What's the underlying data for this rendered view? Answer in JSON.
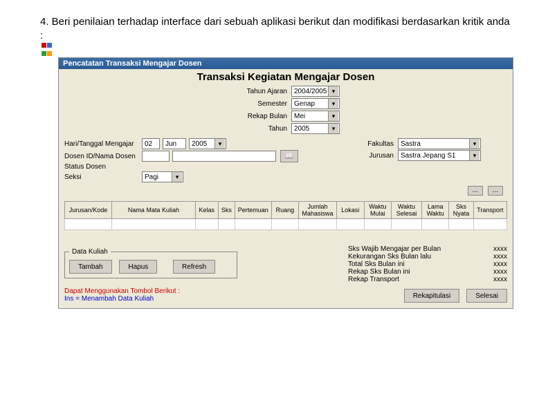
{
  "question": "4. Beri penilaian terhadap interface dari sebuah aplikasi berikut dan modifikasi berdasarkan kritik anda :",
  "window_title": "Pencatatan Transaksi Mengajar Dosen",
  "header": "Transaksi Kegiatan Mengajar Dosen",
  "top": {
    "tahun_ajaran_lbl": "Tahun Ajaran",
    "tahun_ajaran_val": "2004/2005",
    "semester_lbl": "Semester",
    "semester_val": "Genap",
    "rekap_bulan_lbl": "Rekap Bulan",
    "rekap_bulan_val": "Mei",
    "tahun_lbl": "Tahun",
    "tahun_val": "2005"
  },
  "left": {
    "hari_lbl": "Hari/Tanggal Mengajar",
    "hari_d": "02",
    "hari_m": "Jun",
    "hari_y": "2005",
    "dosen_lbl": "Dosen ID/Nama Dosen",
    "dosen_id": "",
    "dosen_nama": "",
    "status_lbl": "Status Dosen",
    "seksi_lbl": "Seksi",
    "seksi_val": "Pagi"
  },
  "right": {
    "fakultas_lbl": "Fakultas",
    "fakultas_val": "Sastra",
    "jurusan_lbl": "Jurusan",
    "jurusan_val": "Sastra Jepang S1"
  },
  "pager": {
    "p1": "...",
    "p2": "..."
  },
  "cols": {
    "c1": "Jurusan/Kode",
    "c2": "Nama Mata Kuliah",
    "c3": "Kelas",
    "c4": "Sks",
    "c5": "Pertemuan",
    "c6": "Ruang",
    "c7": "Jumlah Mahasiswa",
    "c8": "Lokasi",
    "c9": "Waktu Mulai",
    "c10": "Waktu Selesai",
    "c11": "Lama Waktu",
    "c12": "Sks Nyata",
    "c13": "Transport"
  },
  "datakuliah": {
    "legend": "Data Kuliah",
    "tambah": "Tambah",
    "hapus": "Hapus",
    "refresh": "Refresh"
  },
  "summary": {
    "s1": "Sks Wajib Mengajar per Bulan",
    "s1v": "xxxx",
    "s2": "Kekurangan Sks Bulan lalu",
    "s2v": "xxxx",
    "s3": "Total Sks Bulan ini",
    "s3v": "xxxx",
    "s4": "Rekap Sks Bulan ini",
    "s4v": "xxxx",
    "s5": "Rekap Transport",
    "s5v": "xxxx"
  },
  "footer": {
    "line1": "Dapat Menggunakan Tombol Berikut :",
    "line2": "Ins = Menambah Data Kuliah",
    "rekap": "Rekapitulasi",
    "selesai": "Selesai"
  },
  "icons": {
    "book": "📖"
  }
}
